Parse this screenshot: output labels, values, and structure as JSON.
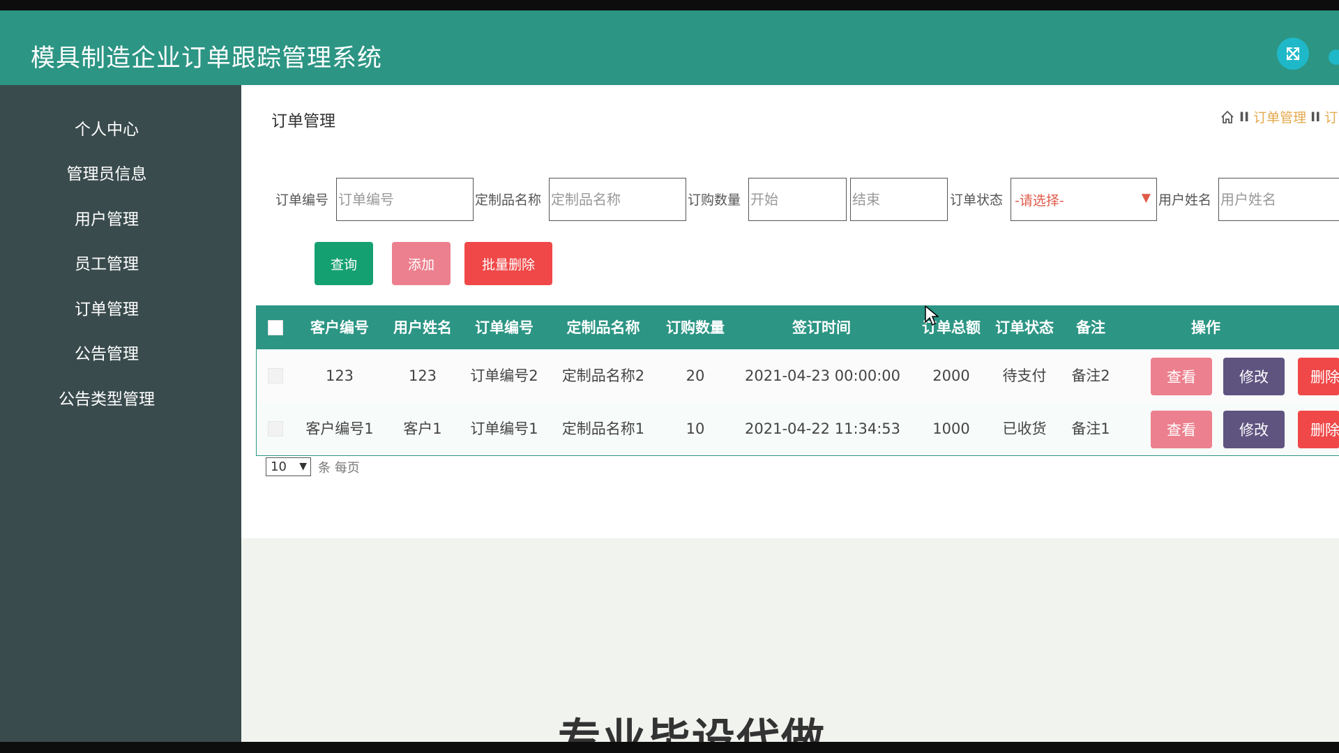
{
  "app": {
    "title": "模具制造企业订单跟踪管理系统"
  },
  "header": {
    "fullscreen_icon": "fullscreen-toggle-icon",
    "accent": "#2c9584"
  },
  "sidebar": {
    "items": [
      {
        "label": "个人中心"
      },
      {
        "label": "管理员信息"
      },
      {
        "label": "用户管理"
      },
      {
        "label": "员工管理"
      },
      {
        "label": "订单管理"
      },
      {
        "label": "公告管理"
      },
      {
        "label": "公告类型管理"
      }
    ]
  },
  "page": {
    "title": "订单管理"
  },
  "breadcrumb": {
    "separator": "II",
    "current": "订单管理",
    "next": "订"
  },
  "filters": {
    "order_no_label": "订单编号",
    "order_no_placeholder": "订单编号",
    "product_name_label": "定制品名称",
    "product_name_placeholder": "定制品名称",
    "quantity_label": "订购数量",
    "quantity_start_placeholder": "开始",
    "quantity_end_placeholder": "结束",
    "status_label": "订单状态",
    "status_value": "-请选择-",
    "user_name_label": "用户姓名",
    "user_name_placeholder": "用户姓名"
  },
  "actions": {
    "query": "查询",
    "add": "添加",
    "batch_delete": "批量删除"
  },
  "table": {
    "headers": [
      "客户编号",
      "用户姓名",
      "订单编号",
      "定制品名称",
      "订购数量",
      "签订时间",
      "订单总额",
      "订单状态",
      "备注",
      "操作"
    ],
    "rows": [
      [
        "123",
        "123",
        "订单编号2",
        "定制品名称2",
        "20",
        "2021-04-23 00:00:00",
        "2000",
        "待支付",
        "备注2"
      ],
      [
        "客户编号1",
        "客户1",
        "订单编号1",
        "定制品名称1",
        "10",
        "2021-04-22 11:34:53",
        "1000",
        "已收货",
        "备注1"
      ]
    ],
    "row_actions": {
      "view": "查看",
      "edit": "修改",
      "delete": "删除"
    }
  },
  "pagination": {
    "page_size": "10",
    "suffix": "条 每页"
  },
  "watermark": "专业毕设代做"
}
